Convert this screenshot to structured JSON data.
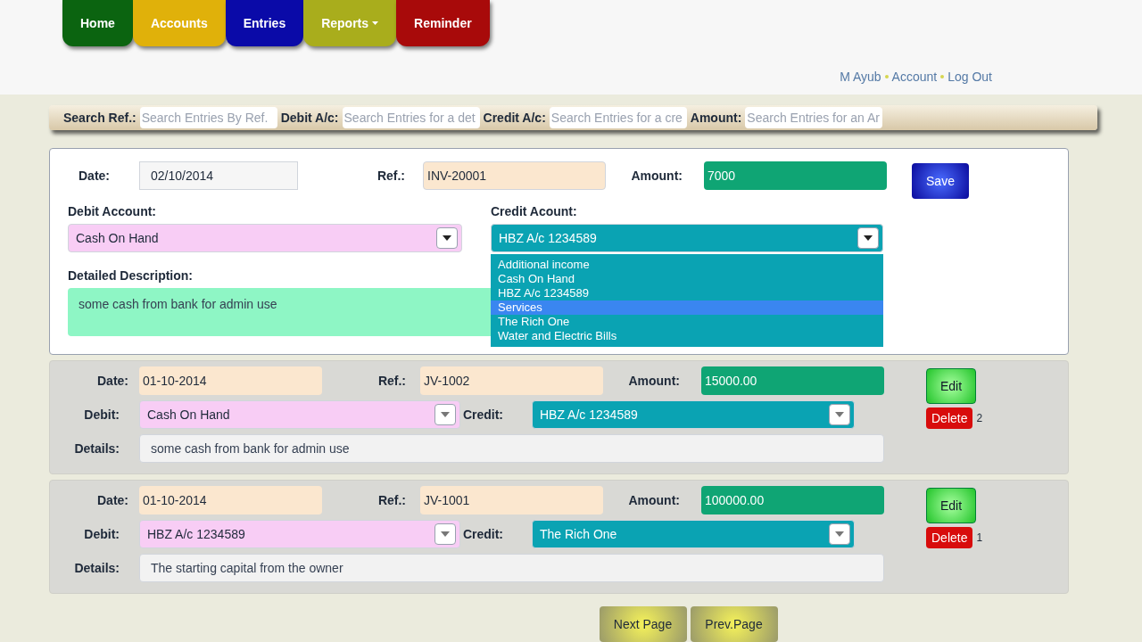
{
  "nav": [
    {
      "label": "Home",
      "color": "#0b6410",
      "caret": false
    },
    {
      "label": "Accounts",
      "color": "#e0b10a",
      "caret": false
    },
    {
      "label": "Entries",
      "color": "#0a0aa8",
      "caret": false
    },
    {
      "label": "Reports",
      "color": "#a9ad1c",
      "caret": true
    },
    {
      "label": "Reminder",
      "color": "#a80a0a",
      "caret": false
    }
  ],
  "user_links": [
    "M Ayub",
    "Account",
    "Log Out"
  ],
  "search": [
    {
      "label": "Search Ref.:",
      "placeholder": "Search Entries By Ref."
    },
    {
      "label": "Debit A/c:",
      "placeholder": "Search Entries for a det"
    },
    {
      "label": "Credit A/c:",
      "placeholder": "Search Entries for a cre"
    },
    {
      "label": "Amount:",
      "placeholder": "Search Entries for an Ar"
    }
  ],
  "form": {
    "date_label": "Date:",
    "date": "02/10/2014",
    "ref_label": "Ref.:",
    "ref": "INV-20001",
    "amount_label": "Amount:",
    "amount": "7000",
    "save": "Save",
    "debit_label": "Debit Account:",
    "debit": "Cash On Hand",
    "credit_label": "Credit Acount:",
    "credit": "HBZ A/c 1234589",
    "description_label": "Detailed Description:",
    "description": "some cash from bank for admin use",
    "credit_options": [
      {
        "label": "Additional income",
        "selected": false
      },
      {
        "label": "Cash On Hand",
        "selected": false
      },
      {
        "label": "HBZ A/c 1234589",
        "selected": false
      },
      {
        "label": "Services",
        "selected": true
      },
      {
        "label": "The Rich One",
        "selected": false
      },
      {
        "label": "Water and Electric Bills",
        "selected": false
      }
    ]
  },
  "entries": [
    {
      "date_label": "Date:",
      "date": "01-10-2014",
      "ref_label": "Ref.:",
      "ref": "JV-1002",
      "amount_label": "Amount:",
      "amount": "15000.00",
      "debit_label": "Debit:",
      "debit": "Cash On Hand",
      "credit_label": "Credit:",
      "credit": "HBZ A/c 1234589",
      "details_label": "Details:",
      "details": "some cash from bank for admin use",
      "edit": "Edit",
      "delete": "Delete",
      "number": "2"
    },
    {
      "date_label": "Date:",
      "date": "01-10-2014",
      "ref_label": "Ref.:",
      "ref": "JV-1001",
      "amount_label": "Amount:",
      "amount": "100000.00",
      "debit_label": "Debit:",
      "debit": "HBZ A/c 1234589",
      "credit_label": "Credit:",
      "credit": "The Rich One",
      "details_label": "Details:",
      "details": "The starting capital from the owner",
      "edit": "Edit",
      "delete": "Delete",
      "number": "1"
    }
  ],
  "pager": [
    "Next Page",
    "Prev.Page"
  ]
}
